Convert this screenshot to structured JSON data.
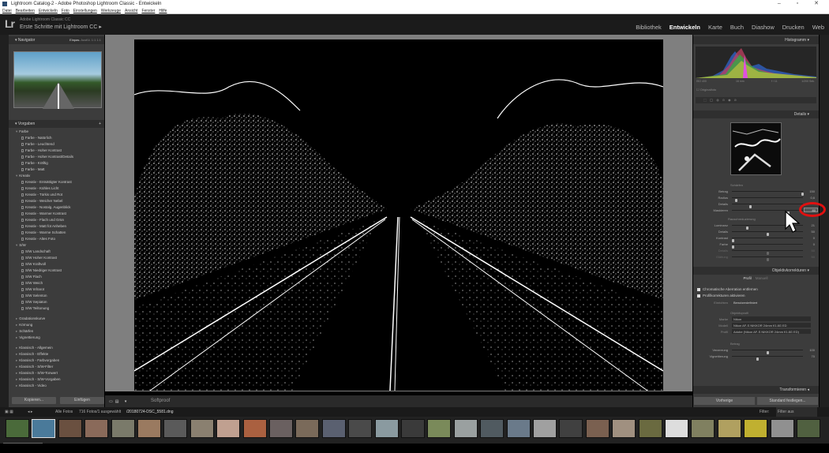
{
  "window": {
    "title": "Lightroom Catalog-2 - Adobe Photoshop Lightroom Classic - Entwickeln",
    "controls": "–  ▫  ✕"
  },
  "menu": [
    "Datei",
    "Bearbeiten",
    "Entwickeln",
    "Foto",
    "Einstellungen",
    "Werkzeuge",
    "Ansicht",
    "Fenster",
    "Hilfe"
  ],
  "identity": {
    "logo": "Lr",
    "product": "Adobe Lightroom Classic CC",
    "catalog": "Erste Schritte mit Lightroom CC"
  },
  "modules": [
    "Bibliothek",
    "Entwickeln",
    "Karte",
    "Buch",
    "Diashow",
    "Drucken",
    "Web"
  ],
  "active_module": "Entwickeln",
  "left_panel": {
    "navigator_title": "Navigator",
    "navigator_modes": [
      "Einpas.",
      "Ausfül.",
      "1:1",
      "1:1"
    ],
    "presets_title": "Vorgaben",
    "preset_groups": [
      {
        "name": "Farbe",
        "items": [
          "Farbe - Natürlich",
          "Farbe - Leuchtend",
          "Farbe - Hoher Kontrast",
          "Farbe - Hoher Kontrast/Details",
          "Farbe - Kräftig",
          "Farbe - Matt"
        ]
      },
      {
        "name": "Kreativ",
        "items": [
          "Kreativ - Entsättigter Kontrast",
          "Kreativ - Kühles Licht",
          "Kreativ - Türkis und Rot",
          "Kreativ - Weicher Nebel",
          "Kreativ - Nostalg. Augenblick",
          "Kreativ - Warmer Kontrast",
          "Kreativ - Flach und Grün",
          "Kreativ - Matt fot Anheben",
          "Kreativ - Warme Schatten",
          "Kreativ - Altes Foto"
        ]
      },
      {
        "name": "S/W",
        "items": [
          "S/W Landschaft",
          "S/W Hoher Kontrast",
          "S/W Kraftvoll",
          "S/W Niedriger Kontrast",
          "S/W Flach",
          "S/W Weich",
          "S/W Infrarot",
          "S/W Selenton",
          "S/W Sepiaton",
          "S/W Teiltonung"
        ]
      }
    ],
    "collapsed_groups": [
      "Gradationskurve",
      "Körnung",
      "Schärfen",
      "Vignettierung"
    ],
    "collapsed_groups_2": [
      "Klassisch - Allgemein",
      "Klassisch - Effekte",
      "Klassisch - Farbvorgaben",
      "Klassisch - S/W-Filter",
      "Klassisch - S/W-Tonwert",
      "Klassisch - S/W-Vorgaben",
      "Klassisch - Video"
    ],
    "copy_button": "Kopieren...",
    "paste_button": "Einfügen"
  },
  "toolbar": {
    "softproof": "Softproof"
  },
  "right_panel": {
    "histogram_title": "Histogramm",
    "histo_info": [
      "ISO 400",
      "16 mm",
      "f / 11",
      "1/200 Sek."
    ],
    "original_photo": "Originalfoto",
    "details_title": "Details",
    "sharpen_label": "Schärfen",
    "sharpen_rows": [
      {
        "label": "Betrag",
        "value": "150",
        "pos": 1.0
      },
      {
        "label": "Radius",
        "value": "0,6",
        "pos": 0.05
      },
      {
        "label": "Details",
        "value": "",
        "pos": 0.25
      },
      {
        "label": "Maskieren",
        "value": "80",
        "pos": 0.8
      }
    ],
    "noise_label": "Rauschreduzierung",
    "noise_rows": [
      {
        "label": "Luminanz",
        "value": "21",
        "pos": 0.21
      },
      {
        "label": "Details",
        "value": "50",
        "pos": 0.5
      },
      {
        "label": "Kontrast",
        "value": "0",
        "pos": 0.0
      },
      {
        "label": "Farbe",
        "value": "0",
        "pos": 0.0
      },
      {
        "label": "Details",
        "value": "50",
        "pos": 0.5
      },
      {
        "label": "Glättung",
        "value": "50",
        "pos": 0.5
      }
    ],
    "lens_title": "Objektivkorrekturen",
    "lens_tabs": [
      "Profil",
      "Manuell"
    ],
    "lens_checks": [
      "Chromatische Aberration entfernen",
      "Profilkorrekturen aktivieren"
    ],
    "setup_label": "Einrichten",
    "setup_value": "Benutzerdefiniert",
    "lens_profile_label": "Objektivprofil",
    "lens_fields": [
      {
        "label": "Marke",
        "value": "Nikon"
      },
      {
        "label": "Modell",
        "value": "Nikon AF-S NIKKOR 24mm f/1.8G ED"
      },
      {
        "label": "Profil",
        "value": "Adobe (Nikon AF-S NIKKOR 24mm f/1.8G ED)"
      }
    ],
    "amount_label": "Betrag",
    "amount_rows": [
      {
        "label": "Verzerrung",
        "value": "100",
        "pos": 0.5
      },
      {
        "label": "Vignettierung",
        "value": "70",
        "pos": 0.35
      }
    ],
    "transform_title": "Transformieren",
    "prev_button": "Vorherige",
    "reset_button": "Standard festlegen..."
  },
  "filmstrip_bar": {
    "source": "Alle Fotos",
    "count": "716 Fotos/1 ausgewählt",
    "filename": "/20180724-DSC_5581.dng",
    "filter_label": "Filter:",
    "filter_value": "Filter aus"
  },
  "colors": {
    "annotation": "#e01010",
    "panel": "#3c3c3c",
    "background": "#000000"
  }
}
